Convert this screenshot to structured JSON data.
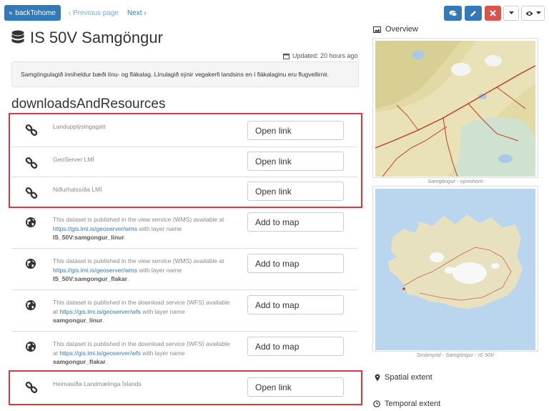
{
  "header": {
    "back_label": "backTohome",
    "prev_label": "‹ Previous page",
    "next_label": "Next ›",
    "toolbar": {
      "comment_icon": "comments-icon",
      "edit_icon": "pencil-icon",
      "delete_icon": "close-icon",
      "dropdown_icon": "caret-down-icon",
      "view_icon": "eye-icon"
    }
  },
  "record": {
    "title": "IS 50V Samgöngur",
    "updated": "Updated: 20 hours ago",
    "description": "Samgöngulagið inniheldur bæði línu- og flákalag. Línulagið sýnir vegakerfi landsins en í flákalaginu eru flugvellirnir."
  },
  "downloads": {
    "heading": "downloadsAndResources",
    "items": [
      {
        "icon": "link-icon",
        "text": "Landupplýsingagátt",
        "button": "Open link"
      },
      {
        "icon": "link-icon",
        "text": "GeoServer LMÍ",
        "button": "Open link"
      },
      {
        "icon": "link-icon",
        "text": "Niðurhalssíða LMÍ",
        "button": "Open link"
      },
      {
        "icon": "globe-icon",
        "pre": "This dataset is published in the view service (WMS) available at ",
        "url": "https://gis.lmi.is/geoserver/wms",
        "mid": " with layer name ",
        "layer": "IS_50V:samgongur_linur",
        "post": ".",
        "button": "Add to map"
      },
      {
        "icon": "globe-icon",
        "pre": "This dataset is published in the view service (WMS) available at ",
        "url": "https://gis.lmi.is/geoserver/wms",
        "mid": " with layer name ",
        "layer": "IS_50V:samgongur_flakar",
        "post": ".",
        "button": "Add to map"
      },
      {
        "icon": "globe-icon",
        "pre": "This dataset is published in the download service (WFS) available at ",
        "url": "https://gis.lmi.is/geoserver/wfs",
        "mid": " with layer name ",
        "layer": "samgongur_linur",
        "post": ".",
        "button": "Add to map"
      },
      {
        "icon": "globe-icon",
        "pre": "This dataset is published in the download service (WFS) available at ",
        "url": "https://gis.lmi.is/geoserver/wfs",
        "mid": " with layer name ",
        "layer": "samgongur_flakar",
        "post": ".",
        "button": "Add to map"
      },
      {
        "icon": "link-icon",
        "text": "Heimasíða Landmælinga Íslands",
        "button": "Open link"
      }
    ]
  },
  "sidebar": {
    "overview_label": "Overview",
    "image1_caption": "Samgöngur - sýnishorn",
    "image2_caption": "Smámynd - Samgöngur - IS 50V",
    "spatial_label": "Spatial extent",
    "temporal_label": "Temporal extent"
  },
  "colors": {
    "primary": "#337ab7",
    "danger": "#d9534f",
    "highlight_box": "#d9383f"
  }
}
